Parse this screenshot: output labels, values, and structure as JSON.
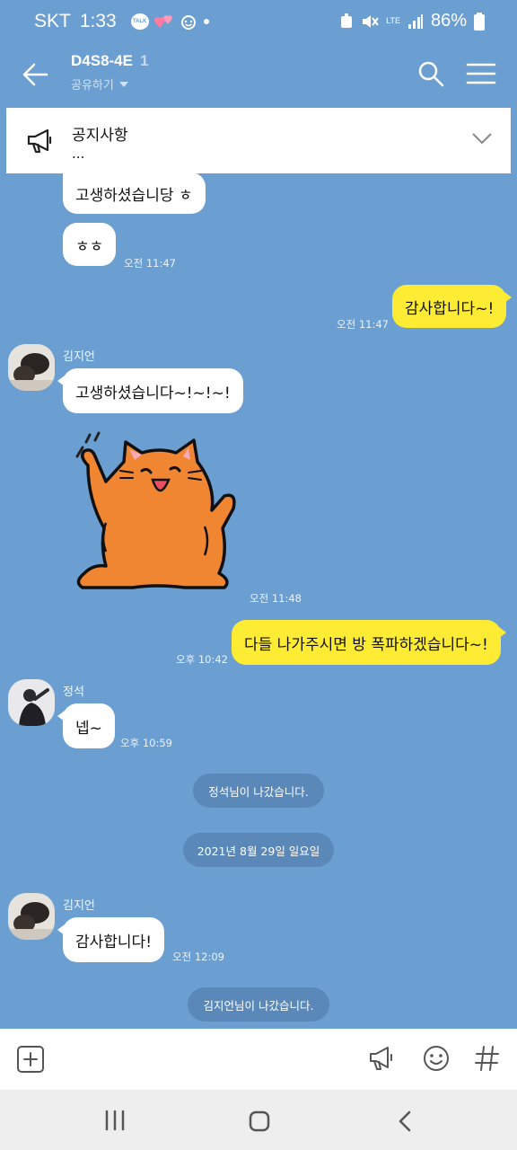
{
  "status_bar": {
    "carrier": "SKT",
    "time": "1:33",
    "talk_badge": "TALK",
    "lte": "LTE",
    "battery": "86%"
  },
  "header": {
    "title": "D4S8-4E",
    "member_count": "1",
    "share_label": "공유하기"
  },
  "notice": {
    "title": "공지사항",
    "subtitle": "..."
  },
  "messages": {
    "m1": {
      "text": "고생하셨습니당 ㅎ"
    },
    "m2": {
      "text": "ㅎㅎ",
      "time": "오전 11:47"
    },
    "m3": {
      "text": "감사합니다~!",
      "time": "오전 11:47"
    },
    "m4": {
      "sender": "김지언",
      "text": "고생하셨습니다~!~!~!"
    },
    "m5": {
      "time": "오전 11:48"
    },
    "m6": {
      "text": "다들 나가주시면 방 폭파하겠습니다~!",
      "time": "오후 10:42"
    },
    "m7": {
      "sender": "정석",
      "text": "넵~",
      "time": "오후 10:59"
    },
    "m8": {
      "sender": "김지언",
      "text": "감사합니다!",
      "time": "오전 12:09"
    }
  },
  "system": {
    "left1": "정석님이 나갔습니다.",
    "date": "2021년 8월 29일 일요일",
    "left2": "김지언님이 나갔습니다."
  },
  "icons": [
    "back-arrow-icon",
    "search-icon",
    "menu-icon",
    "megaphone-icon",
    "chevron-down-icon",
    "plus-icon",
    "emoji-icon",
    "hash-icon",
    "recent-apps-icon",
    "home-icon",
    "nav-back-icon"
  ],
  "colors": {
    "chat_bg": "#6b9fd2",
    "my_bubble": "#fdeb34",
    "other_bubble": "#ffffff",
    "system_pill": "#5a88b8"
  }
}
